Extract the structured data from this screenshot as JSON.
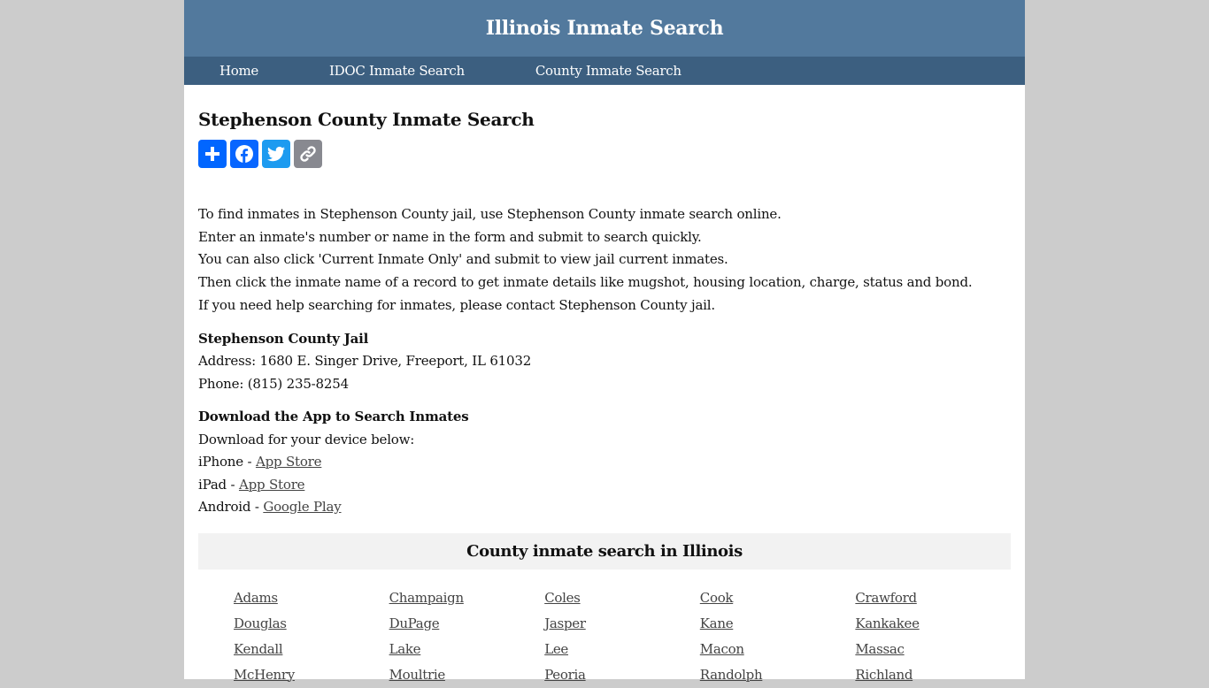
{
  "header": {
    "site_title": "Illinois Inmate Search"
  },
  "nav": {
    "items": [
      {
        "label": "Home"
      },
      {
        "label": "IDOC Inmate Search"
      },
      {
        "label": "County Inmate Search"
      }
    ]
  },
  "main": {
    "title": "Stephenson County Inmate Search",
    "share_buttons": [
      {
        "icon": "plus-icon",
        "label": "Share",
        "color": "#0166ff"
      },
      {
        "icon": "facebook-icon",
        "label": "Facebook",
        "color": "#0866ff"
      },
      {
        "icon": "twitter-icon",
        "label": "Twitter",
        "color": "#1d9bf0"
      },
      {
        "icon": "link-icon",
        "label": "Copy Link",
        "color": "#888990"
      }
    ],
    "intro_lines": [
      "To find inmates in Stephenson County jail, use Stephenson County inmate search online.",
      "Enter an inmate's number or name in the form and submit to search quickly.",
      "You can also click 'Current Inmate Only' and submit to view jail current inmates.",
      "Then click the inmate name of a record to get inmate details like mugshot, housing location, charge, status and bond.",
      "If you need help searching for inmates, please contact Stephenson County jail."
    ],
    "jail": {
      "heading": "Stephenson County Jail",
      "address": "Address: 1680 E. Singer Drive, Freeport, IL 61032",
      "phone": "Phone: (815) 235-8254"
    },
    "app": {
      "heading": "Download the App to Search Inmates",
      "subtext": "Download for your device below:",
      "devices": [
        {
          "prefix": "iPhone - ",
          "link": "App Store"
        },
        {
          "prefix": "iPad - ",
          "link": "App Store"
        },
        {
          "prefix": "Android - ",
          "link": "Google Play"
        }
      ]
    },
    "counties": {
      "title": "County inmate search in Illinois",
      "items": [
        "Adams",
        "Champaign",
        "Coles",
        "Cook",
        "Crawford",
        "Douglas",
        "DuPage",
        "Jasper",
        "Kane",
        "Kankakee",
        "Kendall",
        "Lake",
        "Lee",
        "Macon",
        "Massac",
        "McHenry",
        "Moultrie",
        "Peoria",
        "Randolph",
        "Richland"
      ]
    }
  },
  "colors": {
    "header_bg": "#52799d",
    "nav_bg": "#3c5f80",
    "page_bg": "#cccccc",
    "county_box_bg": "#f2f2f2"
  }
}
